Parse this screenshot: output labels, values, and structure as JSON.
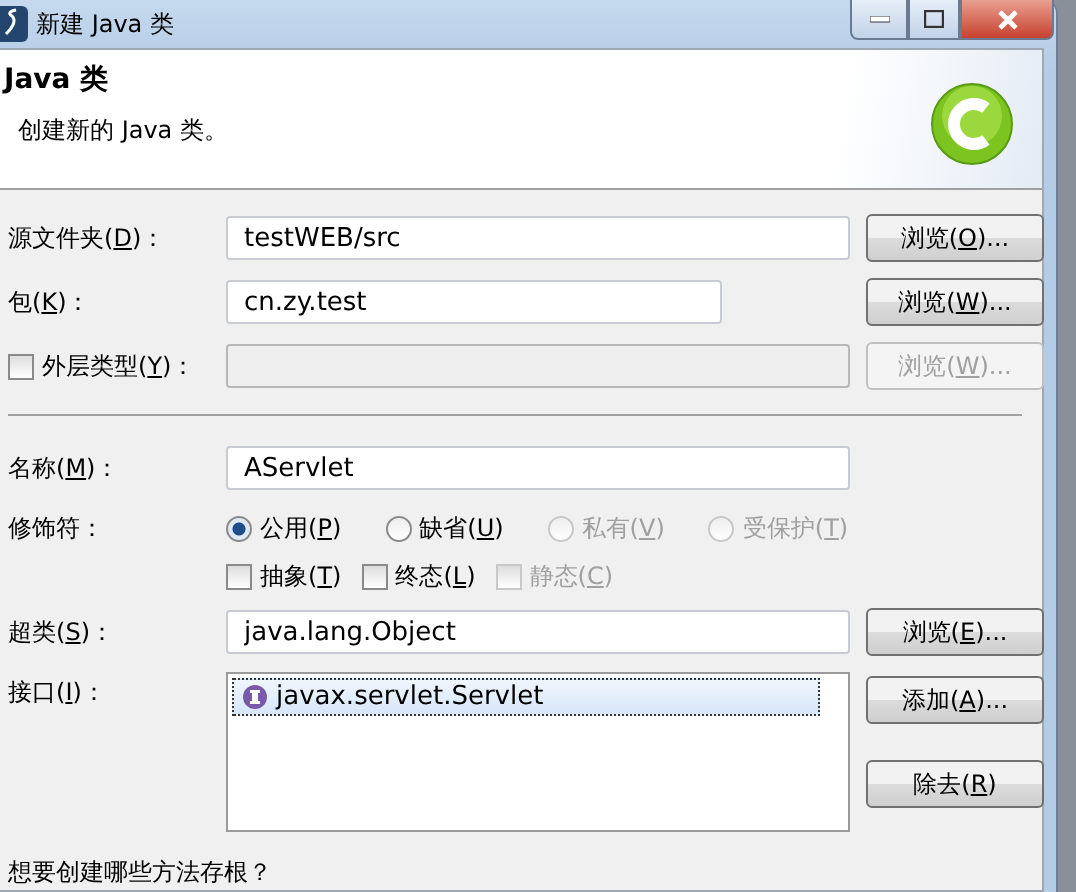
{
  "window": {
    "title": "新建 Java 类"
  },
  "header": {
    "title": "Java 类",
    "description": "创建新的 Java 类。"
  },
  "source_folder": {
    "label": {
      "pre": "源文件夹(",
      "key": "D",
      "post": ")："
    },
    "value": "testWEB/src",
    "button": {
      "pre": "浏览(",
      "key": "O",
      "post": ")...",
      "disabled": false
    }
  },
  "package": {
    "label": {
      "pre": "包(",
      "key": "K",
      "post": ")："
    },
    "value": "cn.zy.test",
    "button": {
      "pre": "浏览(",
      "key": "W",
      "post": ")...",
      "disabled": false
    }
  },
  "enclosing_type": {
    "checked": false,
    "label": {
      "pre": "外层类型(",
      "key": "Y",
      "post": ")："
    },
    "disabled": true,
    "button": {
      "pre": "浏览(",
      "key": "W",
      "post": ")...",
      "disabled": true
    }
  },
  "name": {
    "label": {
      "pre": "名称(",
      "key": "M",
      "post": ")："
    },
    "value": "AServlet"
  },
  "modifiers": {
    "label": {
      "pre": "修饰符："
    },
    "radios": [
      {
        "label": {
          "pre": "公用(",
          "key": "P",
          "post": ")"
        },
        "selected": true,
        "disabled": false
      },
      {
        "label": {
          "pre": "缺省(",
          "key": "U",
          "post": ")"
        },
        "selected": false,
        "disabled": false
      },
      {
        "label": {
          "pre": "私有(",
          "key": "V",
          "post": ")"
        },
        "selected": false,
        "disabled": true
      },
      {
        "label": {
          "pre": "受保护(",
          "key": "T",
          "post": ")"
        },
        "selected": false,
        "disabled": true
      }
    ],
    "checkboxes": [
      {
        "label": {
          "pre": "抽象(",
          "key": "T",
          "post": ")"
        },
        "checked": false,
        "disabled": false
      },
      {
        "label": {
          "pre": "终态(",
          "key": "L",
          "post": ")"
        },
        "checked": false,
        "disabled": false
      },
      {
        "label": {
          "pre": "静态(",
          "key": "C",
          "post": ")"
        },
        "checked": false,
        "disabled": true
      }
    ]
  },
  "superclass": {
    "label": {
      "pre": "超类(",
      "key": "S",
      "post": ")："
    },
    "value": "java.lang.Object",
    "button": {
      "pre": "浏览(",
      "key": "E",
      "post": ")...",
      "disabled": false
    }
  },
  "interfaces": {
    "label": {
      "pre": "接口(",
      "key": "I",
      "post": ")："
    },
    "items": [
      {
        "name": "javax.servlet.Servlet",
        "selected": true
      }
    ],
    "buttons": [
      {
        "pre": "添加(",
        "key": "A",
        "post": ")...",
        "disabled": false
      },
      {
        "pre": "除去(",
        "key": "R",
        "post": ")",
        "disabled": false
      }
    ]
  },
  "stubs_question": "想要创建哪些方法存根？"
}
